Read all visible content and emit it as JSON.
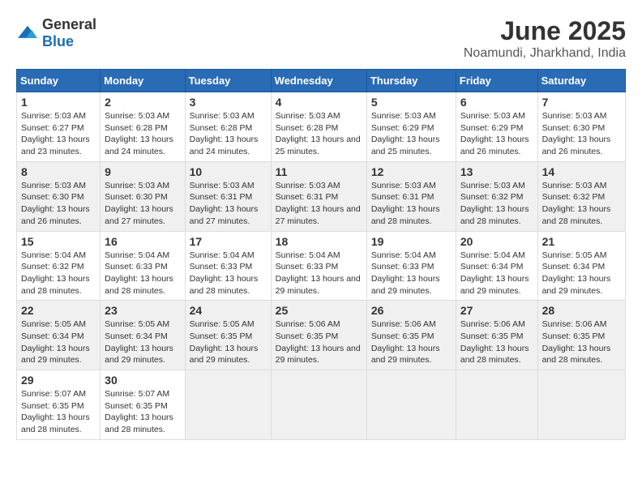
{
  "logo": {
    "general": "General",
    "blue": "Blue"
  },
  "title": "June 2025",
  "subtitle": "Noamundi, Jharkhand, India",
  "headers": [
    "Sunday",
    "Monday",
    "Tuesday",
    "Wednesday",
    "Thursday",
    "Friday",
    "Saturday"
  ],
  "weeks": [
    [
      {
        "day": "1",
        "sunrise": "5:03 AM",
        "sunset": "6:27 PM",
        "daylight": "13 hours and 23 minutes."
      },
      {
        "day": "2",
        "sunrise": "5:03 AM",
        "sunset": "6:28 PM",
        "daylight": "13 hours and 24 minutes."
      },
      {
        "day": "3",
        "sunrise": "5:03 AM",
        "sunset": "6:28 PM",
        "daylight": "13 hours and 24 minutes."
      },
      {
        "day": "4",
        "sunrise": "5:03 AM",
        "sunset": "6:28 PM",
        "daylight": "13 hours and 25 minutes."
      },
      {
        "day": "5",
        "sunrise": "5:03 AM",
        "sunset": "6:29 PM",
        "daylight": "13 hours and 25 minutes."
      },
      {
        "day": "6",
        "sunrise": "5:03 AM",
        "sunset": "6:29 PM",
        "daylight": "13 hours and 26 minutes."
      },
      {
        "day": "7",
        "sunrise": "5:03 AM",
        "sunset": "6:30 PM",
        "daylight": "13 hours and 26 minutes."
      }
    ],
    [
      {
        "day": "8",
        "sunrise": "5:03 AM",
        "sunset": "6:30 PM",
        "daylight": "13 hours and 26 minutes."
      },
      {
        "day": "9",
        "sunrise": "5:03 AM",
        "sunset": "6:30 PM",
        "daylight": "13 hours and 27 minutes."
      },
      {
        "day": "10",
        "sunrise": "5:03 AM",
        "sunset": "6:31 PM",
        "daylight": "13 hours and 27 minutes."
      },
      {
        "day": "11",
        "sunrise": "5:03 AM",
        "sunset": "6:31 PM",
        "daylight": "13 hours and 27 minutes."
      },
      {
        "day": "12",
        "sunrise": "5:03 AM",
        "sunset": "6:31 PM",
        "daylight": "13 hours and 28 minutes."
      },
      {
        "day": "13",
        "sunrise": "5:03 AM",
        "sunset": "6:32 PM",
        "daylight": "13 hours and 28 minutes."
      },
      {
        "day": "14",
        "sunrise": "5:03 AM",
        "sunset": "6:32 PM",
        "daylight": "13 hours and 28 minutes."
      }
    ],
    [
      {
        "day": "15",
        "sunrise": "5:04 AM",
        "sunset": "6:32 PM",
        "daylight": "13 hours and 28 minutes."
      },
      {
        "day": "16",
        "sunrise": "5:04 AM",
        "sunset": "6:33 PM",
        "daylight": "13 hours and 28 minutes."
      },
      {
        "day": "17",
        "sunrise": "5:04 AM",
        "sunset": "6:33 PM",
        "daylight": "13 hours and 28 minutes."
      },
      {
        "day": "18",
        "sunrise": "5:04 AM",
        "sunset": "6:33 PM",
        "daylight": "13 hours and 29 minutes."
      },
      {
        "day": "19",
        "sunrise": "5:04 AM",
        "sunset": "6:33 PM",
        "daylight": "13 hours and 29 minutes."
      },
      {
        "day": "20",
        "sunrise": "5:04 AM",
        "sunset": "6:34 PM",
        "daylight": "13 hours and 29 minutes."
      },
      {
        "day": "21",
        "sunrise": "5:05 AM",
        "sunset": "6:34 PM",
        "daylight": "13 hours and 29 minutes."
      }
    ],
    [
      {
        "day": "22",
        "sunrise": "5:05 AM",
        "sunset": "6:34 PM",
        "daylight": "13 hours and 29 minutes."
      },
      {
        "day": "23",
        "sunrise": "5:05 AM",
        "sunset": "6:34 PM",
        "daylight": "13 hours and 29 minutes."
      },
      {
        "day": "24",
        "sunrise": "5:05 AM",
        "sunset": "6:35 PM",
        "daylight": "13 hours and 29 minutes."
      },
      {
        "day": "25",
        "sunrise": "5:06 AM",
        "sunset": "6:35 PM",
        "daylight": "13 hours and 29 minutes."
      },
      {
        "day": "26",
        "sunrise": "5:06 AM",
        "sunset": "6:35 PM",
        "daylight": "13 hours and 29 minutes."
      },
      {
        "day": "27",
        "sunrise": "5:06 AM",
        "sunset": "6:35 PM",
        "daylight": "13 hours and 28 minutes."
      },
      {
        "day": "28",
        "sunrise": "5:06 AM",
        "sunset": "6:35 PM",
        "daylight": "13 hours and 28 minutes."
      }
    ],
    [
      {
        "day": "29",
        "sunrise": "5:07 AM",
        "sunset": "6:35 PM",
        "daylight": "13 hours and 28 minutes."
      },
      {
        "day": "30",
        "sunrise": "5:07 AM",
        "sunset": "6:35 PM",
        "daylight": "13 hours and 28 minutes."
      },
      null,
      null,
      null,
      null,
      null
    ]
  ]
}
